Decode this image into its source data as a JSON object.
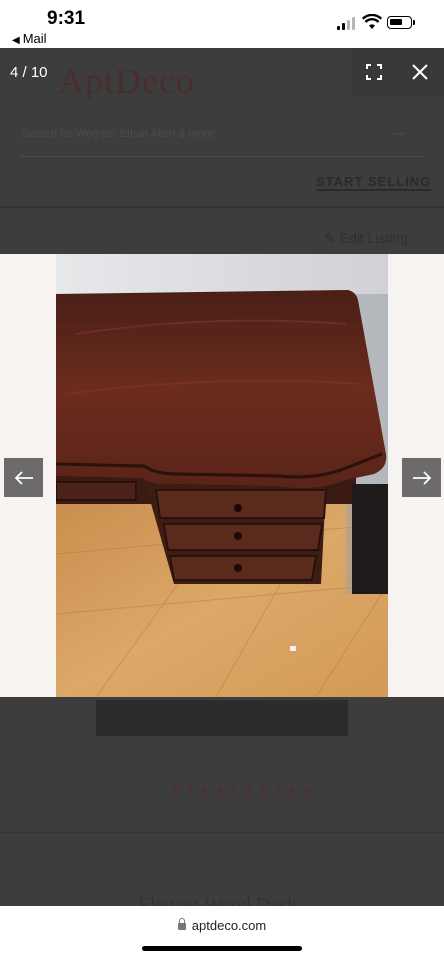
{
  "status_bar": {
    "time": "9:31",
    "back_label": "Mail"
  },
  "background_page": {
    "logo": "AptDeco",
    "search_placeholder": "Search for Wegner, Ethan Allen & more",
    "start_selling": "START SELLING",
    "edit_listing": "Edit Listing",
    "product_title": "Elegant Wood Desk"
  },
  "lightbox": {
    "counter": "4 / 10",
    "current_index": 4,
    "total_images": 10,
    "photo_subject": "dark cherry wood desk with drawers on hardwood floor"
  },
  "browser": {
    "url": "aptdeco.com"
  },
  "colors": {
    "overlay": "#3b3b3b",
    "nav_button": "#6c6a6a",
    "photo_backdrop": "#f6f3f1",
    "brand_dimmed": "#4a2e2e"
  },
  "icons": {
    "prev": "arrow-left-icon",
    "next": "arrow-right-icon",
    "fullscreen": "fullscreen-icon",
    "close": "close-icon",
    "lock": "lock-icon"
  }
}
